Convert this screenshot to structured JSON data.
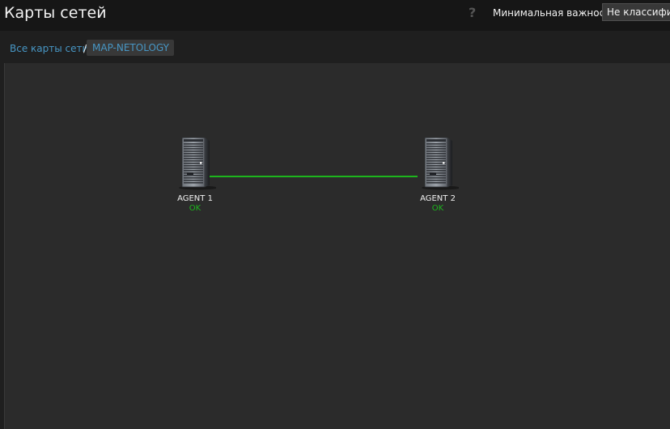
{
  "header": {
    "title": "Карты сетей",
    "help_icon": "question-mark-icon",
    "min_severity_label": "Минимальная важность",
    "min_severity_value": "Не классифицировано"
  },
  "breadcrumb": {
    "all_maps": "Все карты сети",
    "separator": "/",
    "current": "MAP-NETOLOGY"
  },
  "map": {
    "hosts": [
      {
        "label": "AGENT 1",
        "status": "OK",
        "icon": "server-rack-icon"
      },
      {
        "label": "AGENT 2",
        "status": "OK",
        "icon": "server-rack-icon"
      }
    ],
    "link": {
      "from": "AGENT 1",
      "to": "AGENT 2",
      "color": "#1db51d"
    }
  },
  "colors": {
    "link_text": "#4796c4",
    "status_ok": "#1db51d",
    "background": "#2b2b2b"
  }
}
